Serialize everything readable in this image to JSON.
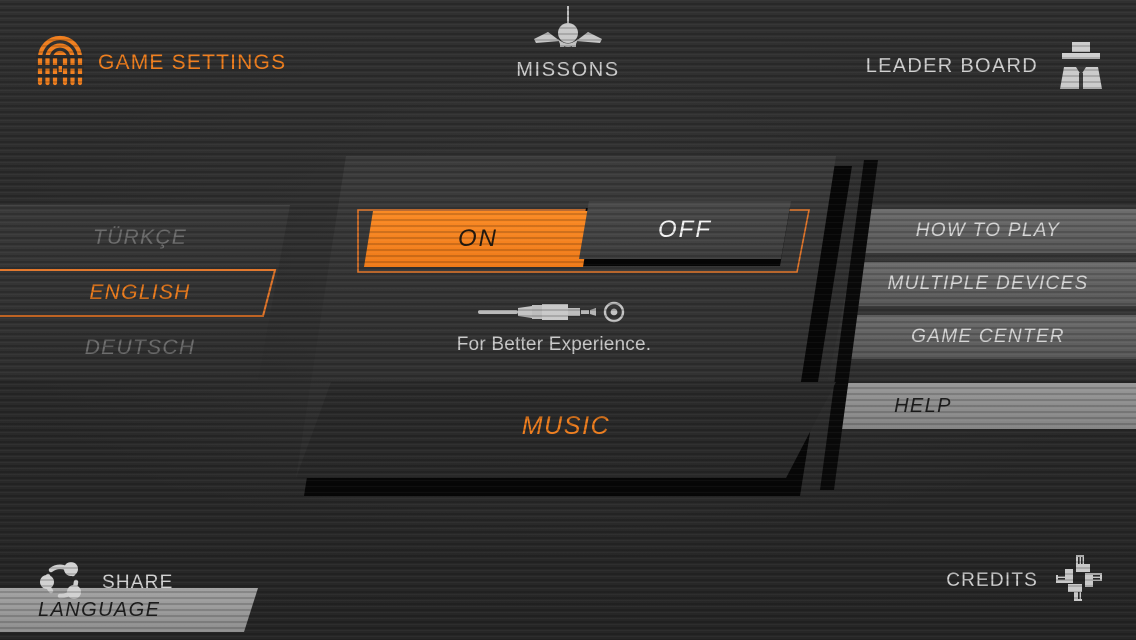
{
  "header": {
    "left": {
      "icon": "fingerprint-icon",
      "label": "GAME SETTINGS"
    },
    "center": {
      "icon": "airplane-icon",
      "label": "MISSONS"
    },
    "right": {
      "icon": "spy-agent-icon",
      "label": "LEADER BOARD"
    }
  },
  "footer": {
    "left": {
      "icon": "share-icon",
      "label": "SHARE"
    },
    "right": {
      "icon": "teamwork-hands-icon",
      "label": "CREDITS"
    }
  },
  "language_panel": {
    "header_label": "LANGUAGE",
    "items": [
      {
        "label": "TÜRKÇE",
        "selected": false
      },
      {
        "label": "ENGLISH",
        "selected": true
      },
      {
        "label": "DEUTSCH",
        "selected": false
      }
    ]
  },
  "music_panel": {
    "title": "MUSIC",
    "toggle": {
      "on_label": "ON",
      "off_label": "OFF",
      "selected": "ON"
    },
    "jack_icon": "audio-jack-icon",
    "caption": "For Better Experience."
  },
  "help_panel": {
    "header_label": "HELP",
    "items": [
      {
        "label": "HOW TO PLAY"
      },
      {
        "label": "MULTIPLE DEVICES"
      },
      {
        "label": "GAME CENTER"
      }
    ]
  },
  "colors": {
    "accent_orange": "#f0801f",
    "panel_dark": "#363636",
    "panel_light_gray": "#999999",
    "menu_gray": "#636363",
    "text_light": "#d4d4d4",
    "text_dim": "#6e6e6e",
    "background": "#2b2b2b"
  }
}
